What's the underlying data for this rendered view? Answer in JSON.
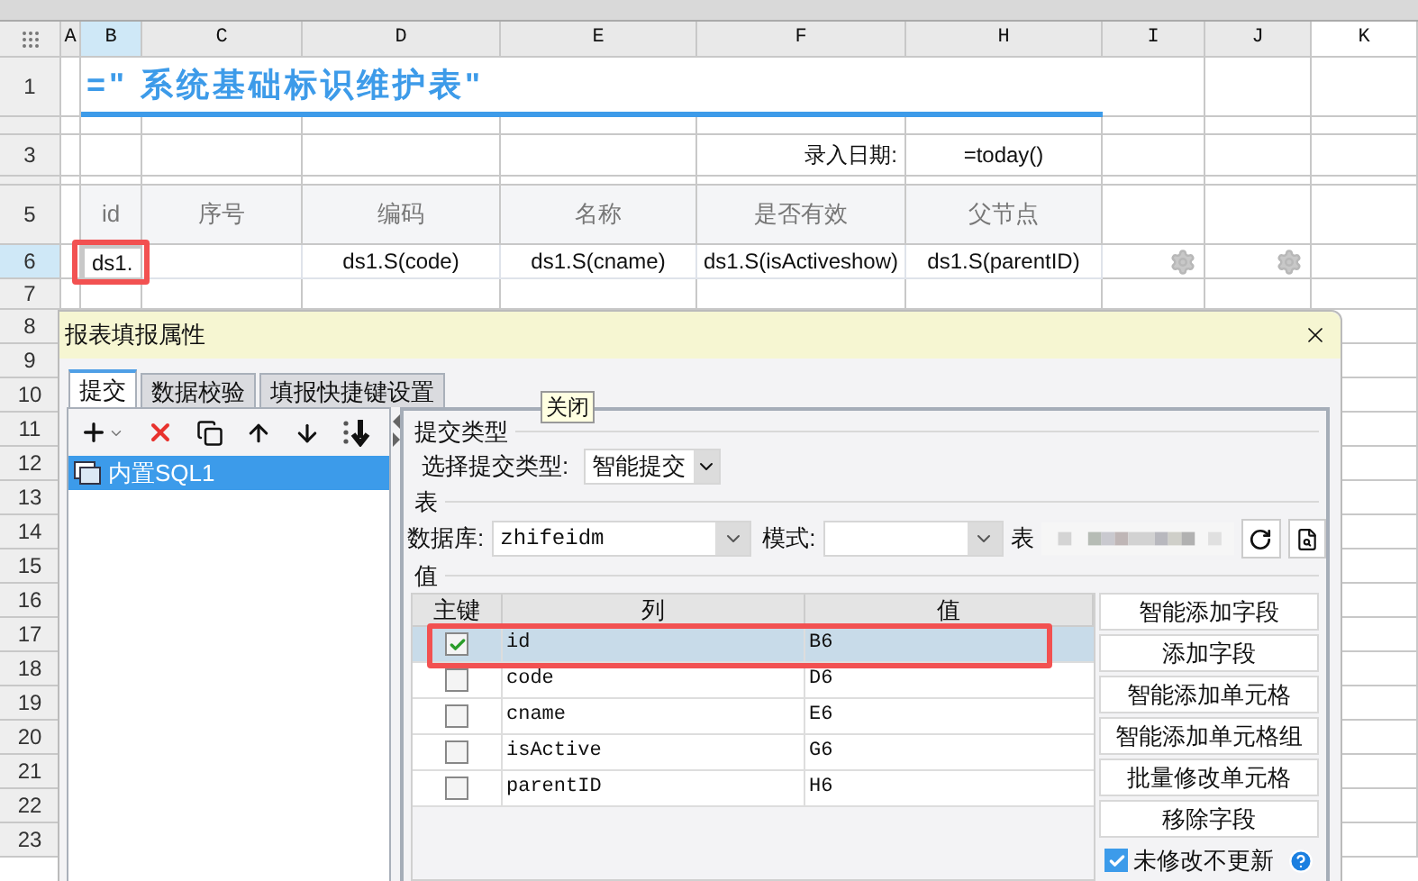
{
  "sheet": {
    "columns": [
      "A",
      "B",
      "C",
      "D",
      "E",
      "F",
      "H",
      "I",
      "J",
      "K"
    ],
    "rows": [
      "1",
      "3",
      "5",
      "6",
      "7",
      "8",
      "9",
      "10",
      "11",
      "12",
      "13",
      "14",
      "15",
      "16",
      "17",
      "18",
      "19",
      "20",
      "21",
      "22",
      "23"
    ],
    "title_formula": "=\" 系统基础标识维护表\"",
    "date_label": "录入日期:",
    "date_formula": "=today()",
    "headers": [
      "id",
      "序号",
      "编码",
      "名称",
      "是否有效",
      "父节点"
    ],
    "data_cells": [
      {
        "text": "ds1.",
        "selected": true
      },
      {
        "selected": false
      },
      {
        "text": "ds1.S(code)",
        "selected": false
      },
      {
        "text": "ds1.S(cname)",
        "selected": false
      },
      {
        "text": "ds1.S(isActiveshow)",
        "selected": false
      },
      {
        "text": "ds1.S(parentID)",
        "selected": false
      }
    ]
  },
  "dialog": {
    "title": "报表填报属性",
    "tooltip": "关闭",
    "tabs": [
      {
        "label": "提交",
        "selected": true
      },
      {
        "label": "数据校验",
        "selected": false
      },
      {
        "label": "填报快捷键设置",
        "selected": false
      }
    ],
    "tree": [
      {
        "label": "内置SQL1",
        "selected": true
      }
    ],
    "submit": {
      "title": "提交类型",
      "type_label": "选择提交类型:",
      "type_value": "智能提交"
    },
    "table": {
      "title": "表",
      "database_label": "数据库:",
      "database_value": "zhifeidm",
      "schema_label": "模式:",
      "table_label": "表"
    },
    "values": {
      "title": "值",
      "columns": [
        "主键",
        "列",
        "值"
      ],
      "rows": [
        {
          "primary_key": true,
          "column": "id",
          "value": "B6",
          "selected": true
        },
        {
          "primary_key": false,
          "column": "code",
          "value": "D6",
          "selected": false
        },
        {
          "primary_key": false,
          "column": "cname",
          "value": "E6",
          "selected": false
        },
        {
          "primary_key": false,
          "column": "isActive",
          "value": "G6",
          "selected": false
        },
        {
          "primary_key": false,
          "column": "parentID",
          "value": "H6",
          "selected": false
        }
      ]
    },
    "buttons": [
      "智能添加字段",
      "添加字段",
      "智能添加单元格",
      "智能添加单元格组",
      "批量修改单元格",
      "移除字段"
    ],
    "skip_unchanged": {
      "label": "未修改不更新",
      "checked": true
    }
  }
}
